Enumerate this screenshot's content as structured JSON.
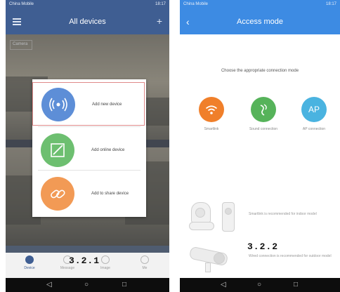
{
  "left_screen": {
    "status": {
      "carrier": "China Mobile",
      "time_area": "18:17"
    },
    "title": "All devices",
    "feed_label": "Camera",
    "popup_items": [
      {
        "label": "Add new device",
        "icon": "wifi-signal-icon",
        "color": "#5d8ed7"
      },
      {
        "label": "Add online device",
        "icon": "edit-icon",
        "color": "#6dbf70"
      },
      {
        "label": "Add to share device",
        "icon": "link-icon",
        "color": "#f29a55"
      }
    ],
    "tabs": [
      {
        "label": "Device"
      },
      {
        "label": "Message"
      },
      {
        "label": "Image"
      },
      {
        "label": "Me"
      }
    ],
    "step_label": "3.2.1"
  },
  "right_screen": {
    "status": {
      "carrier": "China Mobile",
      "time_area": "18:17"
    },
    "title": "Access mode",
    "instruction": "Choose the appropriate connection mode",
    "modes": [
      {
        "label": "Smartlink",
        "icon": "wifi-icon",
        "color": "#f07f2a"
      },
      {
        "label": "Sound connection",
        "icon": "sound-wave-icon",
        "color": "#56b35a"
      },
      {
        "label": "AP connection",
        "icon_text": "AP",
        "color": "#4ab3e0"
      }
    ],
    "notes": [
      "Smartlink is recommended for indoor model",
      "Wired connection is recommended for outdoor model"
    ],
    "step_label": "3.2.2"
  },
  "nav": {
    "back": "◁",
    "home": "○",
    "recent": "□"
  }
}
